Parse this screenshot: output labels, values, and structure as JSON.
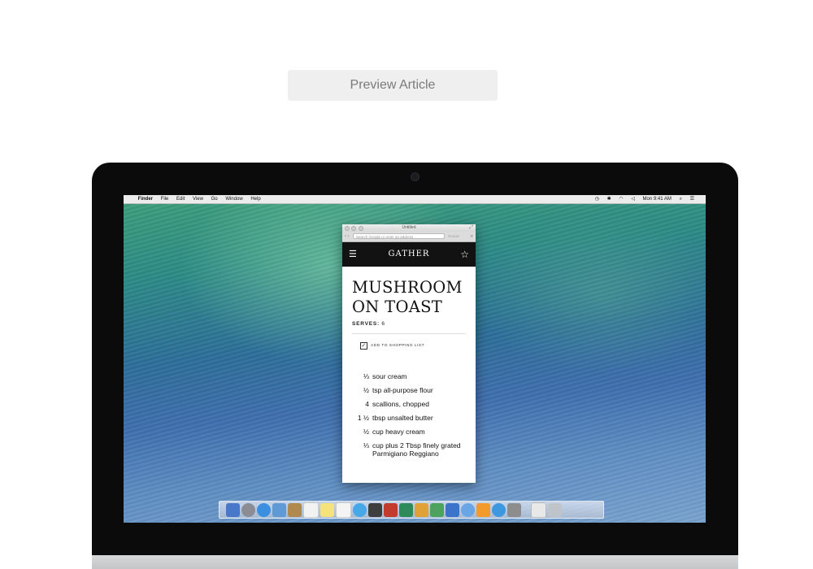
{
  "preview": {
    "label": "Preview Article"
  },
  "menubar": {
    "apple_icon": "apple-icon",
    "app_name": "Finder",
    "items": [
      "File",
      "Edit",
      "View",
      "Go",
      "Window",
      "Help"
    ],
    "clock": "Mon 9:41 AM"
  },
  "browser": {
    "window_title": "Untitled",
    "url_placeholder": "Search Google or enter an address",
    "reader_label": "Reader"
  },
  "app": {
    "title": "GATHER",
    "recipe": {
      "title_line1": "MUSHROOM",
      "title_line2": "ON TOAST",
      "serves_label": "SERVES:",
      "serves_value": "6",
      "shopping_label": "ADD TO SHOPPING LIST",
      "ingredients": [
        {
          "qty": "⅓",
          "text": "sour cream"
        },
        {
          "qty": "½",
          "text": "tsp all-purpose flour"
        },
        {
          "qty": "4",
          "text": "scallions, chopped"
        },
        {
          "qty": "1 ½",
          "text": "tbsp unsalted butter"
        },
        {
          "qty": "½",
          "text": "cup heavy cream"
        },
        {
          "qty": "⅓",
          "text": "cup plus 2 Tbsp finely grated Parmigiano Reggiano"
        }
      ]
    }
  },
  "colors": {
    "app_header": "#121212",
    "button_bg": "#efefef"
  }
}
